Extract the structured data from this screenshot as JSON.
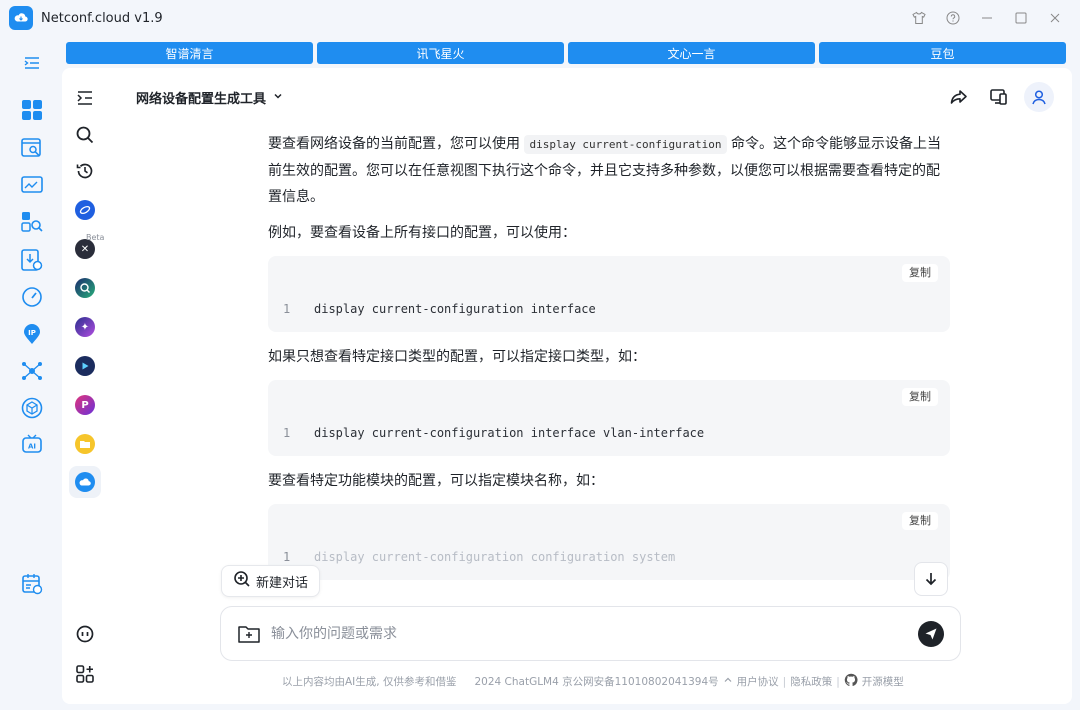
{
  "app": {
    "title": "Netconf.cloud v1.9",
    "accent": "#1f8df0"
  },
  "model_tabs": [
    "智谱清言",
    "讯飞星火",
    "文心一言",
    "豆包"
  ],
  "rail_icons": [
    "menu-collapse-icon",
    "dashboard-grid-icon",
    "config-search-icon",
    "monitor-chart-icon",
    "inspect-icon",
    "config-export-icon",
    "speed-gauge-icon",
    "ip-pin-icon",
    "topology-icon",
    "package-cube-icon",
    "ai-tv-icon",
    "schedule-icon"
  ],
  "side_tools": {
    "beta_badge": "Beta",
    "items": [
      "collapse-icon",
      "search-icon",
      "history-icon",
      "model-ring-icon",
      "model-x-icon",
      "model-q-icon",
      "model-star-icon",
      "model-play-icon",
      "model-p-icon",
      "folder-icon",
      "cloud-icon"
    ],
    "bottom": [
      "feedback-icon",
      "apps-add-icon"
    ]
  },
  "header": {
    "title": "网络设备配置生成工具"
  },
  "content": {
    "intro_a": "要查看网络设备的当前配置，您可以使用",
    "intro_code": "display current-configuration",
    "intro_b": "命令。这个命令能够显示设备上当前生效的配置。您可以在任意视图下执行这个命令，并且它支持多种参数，以便您可以根据需要查看特定的配置信息。",
    "example_intro": "例如，要查看设备上所有接口的配置，可以使用：",
    "copy_label": "复制",
    "code1": {
      "line": "1",
      "text": "display current-configuration interface"
    },
    "type_intro": "如果只想查看特定接口类型的配置，可以指定接口类型，如：",
    "code2": {
      "line": "1",
      "text": "display current-configuration interface vlan-interface"
    },
    "module_intro": "要查看特定功能模块的配置，可以指定模块名称，如：",
    "code3": {
      "line": "1",
      "text": "display current-configuration configuration system"
    }
  },
  "new_chat": {
    "label": "新建对话"
  },
  "input": {
    "placeholder": "输入你的问题或需求"
  },
  "footer": {
    "disclaimer": "以上内容均由AI生成, 仅供参考和借鉴",
    "icp": "2024 ChatGLM4 京公网安备11010802041394号",
    "user_agreement": "用户协议",
    "privacy": "隐私政策",
    "open_model": "开源模型"
  }
}
